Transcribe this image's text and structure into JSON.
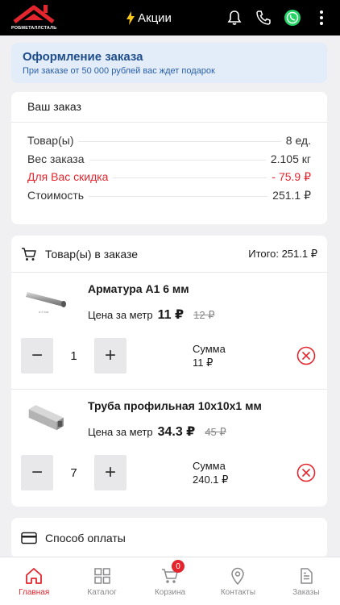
{
  "header": {
    "logo_text": "РОБМЕТАЛЛСТАЛЬ",
    "promo_label": "Акции",
    "icons": [
      "bell-icon",
      "phone-icon",
      "whatsapp-icon",
      "more-vertical-icon"
    ]
  },
  "banner": {
    "title": "Оформление заказа",
    "subtitle": "При заказе от 50 000 рублей вас ждет   подарок"
  },
  "summary": {
    "title": "Ваш заказ",
    "rows": [
      {
        "label": "Товар(ы)",
        "value": "8 ед."
      },
      {
        "label": "Вес заказа",
        "value": "2.105 кг"
      },
      {
        "label": "Для Вас скидка",
        "value": "- 75.9 ₽"
      },
      {
        "label": "Стоимость",
        "value": "251.1 ₽"
      }
    ]
  },
  "items_section": {
    "title": "Товар(ы) в заказе",
    "total": "Итого: 251.1 ₽",
    "items": [
      {
        "name": "Арматура А1 6 мм",
        "price_label": "Цена за метр",
        "price": "11 ₽",
        "old_price": "12 ₽",
        "qty": "1",
        "sum_label": "Сумма",
        "sum": "11 ₽"
      },
      {
        "name": "Труба профильная 10х10х1 мм",
        "price_label": "Цена за метр",
        "price": "34.3 ₽",
        "old_price": "45 ₽",
        "qty": "7",
        "sum_label": "Сумма",
        "sum": "240.1 ₽"
      }
    ],
    "minus": "−",
    "plus": "+"
  },
  "payment": {
    "title": "Способ оплаты"
  },
  "bottom_nav": {
    "items": [
      {
        "label": "Главная",
        "icon": "home-icon",
        "active": true
      },
      {
        "label": "Каталог",
        "icon": "catalog-grid-icon"
      },
      {
        "label": "Корзина",
        "icon": "cart-icon",
        "badge": "0"
      },
      {
        "label": "Контакты",
        "icon": "location-pin-icon"
      },
      {
        "label": "Заказы",
        "icon": "orders-document-icon"
      }
    ]
  },
  "colors": {
    "accent": "#e3262e",
    "banner_bg": "#e3edf9",
    "banner_title": "#1e4d8c",
    "whatsapp": "#25d366"
  }
}
